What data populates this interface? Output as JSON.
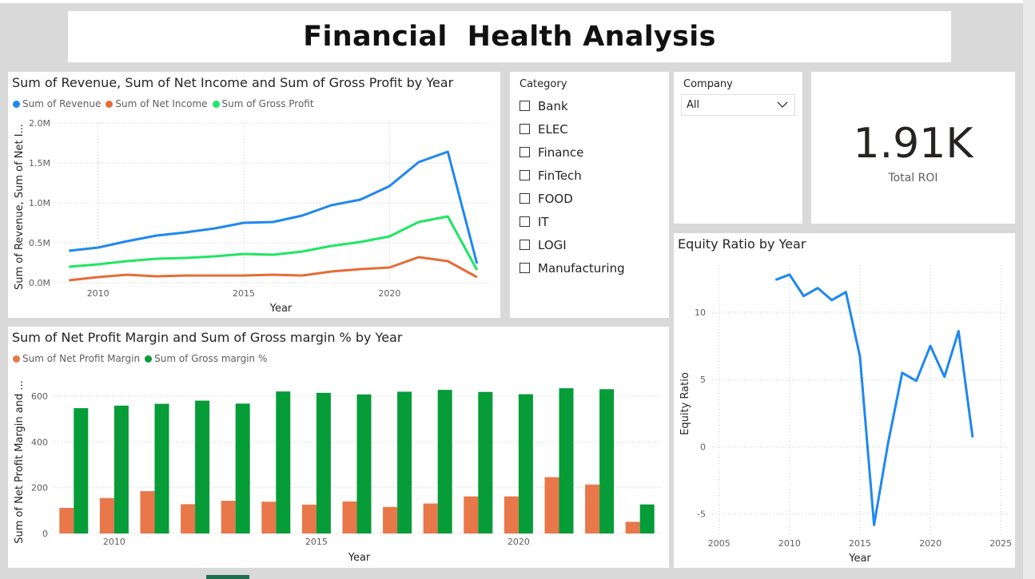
{
  "dashboard": {
    "title": "Financial  Health Analysis"
  },
  "colors": {
    "revenue": "#1e88f0",
    "net_income": "#e66c37",
    "gross_profit": "#1fe663",
    "net_profit_margin": "#e8774a",
    "gross_margin": "#069c37",
    "equity": "#1e88f0"
  },
  "category_slicer": {
    "header": "Category",
    "items": [
      "Bank",
      "ELEC",
      "Finance",
      "FinTech",
      "FOOD",
      "IT",
      "LOGI",
      "Manufacturing"
    ]
  },
  "company_slicer": {
    "header": "Company",
    "selected": "All",
    "icon": "chevron-down-icon"
  },
  "kpi": {
    "value": "1.91K",
    "label": "Total ROI"
  },
  "chart_data": [
    {
      "type": "line",
      "title": "Sum of Revenue, Sum of Net Income and Sum of Gross Profit by Year",
      "xlabel": "Year",
      "ylabel": "Sum of Revenue, Sum of Net I...",
      "x": [
        2009,
        2010,
        2011,
        2012,
        2013,
        2014,
        2015,
        2016,
        2017,
        2018,
        2019,
        2020,
        2021,
        2022,
        2023
      ],
      "series": [
        {
          "name": "Sum of Revenue",
          "values": [
            0.4,
            0.44,
            0.52,
            0.59,
            0.63,
            0.68,
            0.75,
            0.76,
            0.84,
            0.97,
            1.04,
            1.21,
            1.51,
            1.64,
            0.24
          ]
        },
        {
          "name": "Sum of Net Income",
          "values": [
            0.03,
            0.07,
            0.1,
            0.08,
            0.09,
            0.09,
            0.09,
            0.1,
            0.09,
            0.14,
            0.17,
            0.19,
            0.32,
            0.27,
            0.07
          ]
        },
        {
          "name": "Sum of Gross Profit",
          "values": [
            0.2,
            0.23,
            0.27,
            0.3,
            0.31,
            0.33,
            0.36,
            0.35,
            0.39,
            0.46,
            0.51,
            0.58,
            0.76,
            0.83,
            0.16
          ]
        }
      ],
      "yticks": [
        "0.0M",
        "0.5M",
        "1.0M",
        "1.5M",
        "2.0M"
      ],
      "ytick_values": [
        0,
        0.5,
        1.0,
        1.5,
        2.0
      ],
      "xticks": [
        2010,
        2015,
        2020
      ],
      "xlim": [
        2008.5,
        2023.5
      ],
      "ylim": [
        0,
        2.0
      ],
      "units": "M",
      "legend": "top-left",
      "grid": true
    },
    {
      "type": "bar",
      "title": "Sum of Net Profit Margin and Sum of Gross margin % by Year",
      "xlabel": "Year",
      "ylabel": "Sum of Net Profit Margin and ...",
      "categories": [
        2009,
        2010,
        2011,
        2012,
        2013,
        2014,
        2015,
        2016,
        2017,
        2018,
        2019,
        2020,
        2021,
        2022,
        2023
      ],
      "series": [
        {
          "name": "Sum of Net Profit Margin",
          "values": [
            112,
            155,
            185,
            128,
            143,
            139,
            126,
            140,
            116,
            131,
            162,
            162,
            246,
            214,
            51
          ]
        },
        {
          "name": "Sum of Gross margin %",
          "values": [
            548,
            559,
            567,
            581,
            568,
            621,
            615,
            608,
            620,
            628,
            619,
            609,
            635,
            631,
            127
          ]
        }
      ],
      "yticks": [
        0,
        200,
        400,
        600
      ],
      "xticks": [
        2010,
        2015,
        2020
      ],
      "ylim": [
        0,
        660
      ],
      "legend": "top-left",
      "grid": true
    },
    {
      "type": "line",
      "title": "Equity Ratio by Year",
      "xlabel": "Year",
      "ylabel": "Equity Ratio",
      "x": [
        2009,
        2010,
        2011,
        2012,
        2013,
        2014,
        2015,
        2016,
        2017,
        2018,
        2019,
        2020,
        2021,
        2022,
        2023
      ],
      "series": [
        {
          "values": [
            12.4,
            12.8,
            11.2,
            11.8,
            10.9,
            11.5,
            6.7,
            -5.8,
            0.3,
            5.5,
            4.9,
            7.5,
            5.2,
            8.6,
            0.7
          ]
        }
      ],
      "xticks": [
        2005,
        2010,
        2015,
        2020,
        2025
      ],
      "yticks": [
        -5,
        0,
        5,
        10
      ],
      "xlim": [
        2004.5,
        2025.5
      ],
      "ylim": [
        -6.5,
        13.5
      ],
      "grid": true
    }
  ]
}
